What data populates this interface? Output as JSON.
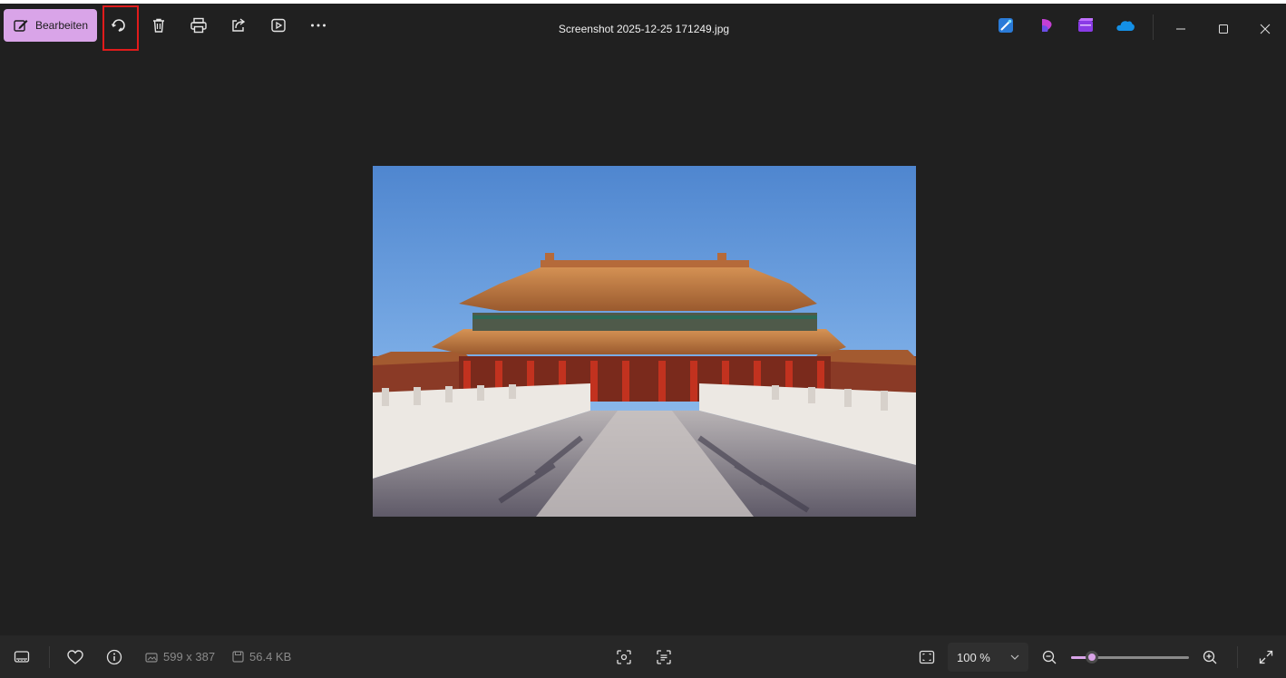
{
  "toolbar": {
    "edit_label": "Bearbeiten",
    "file_title": "Screenshot 2025-12-25 171249.jpg"
  },
  "toolbar_icons": [
    "edit-icon",
    "rotate-icon",
    "delete-icon",
    "print-icon",
    "share-icon",
    "slideshow-icon",
    "more-icon"
  ],
  "app_icons": [
    "designer-icon",
    "clipchamp-icon",
    "clipchamp-video-icon",
    "onedrive-icon"
  ],
  "window_controls": [
    "minimize-icon",
    "maximize-icon",
    "close-icon"
  ],
  "status": {
    "dimensions": "599 x 387",
    "file_size": "56.4 KB"
  },
  "zoom": {
    "level": "100 %",
    "slider_fraction": 0.18
  },
  "colors": {
    "accent": "#d9a4e8",
    "background": "#202020",
    "highlight_box": "#e01b1b"
  }
}
